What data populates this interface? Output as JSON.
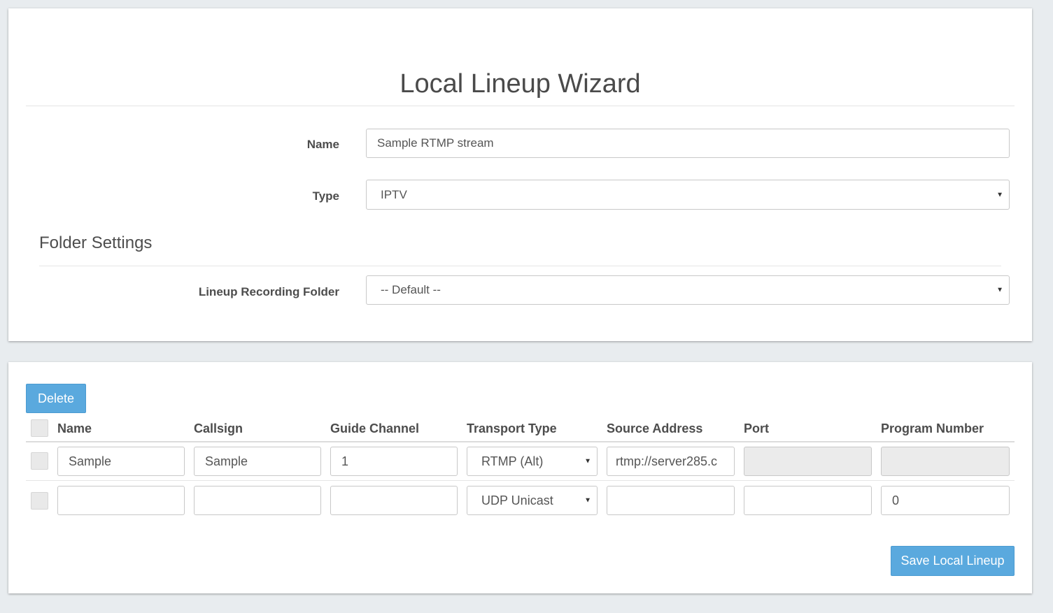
{
  "wizard": {
    "title": "Local Lineup Wizard",
    "name_label": "Name",
    "name_value": "Sample RTMP stream",
    "type_label": "Type",
    "type_value": "IPTV",
    "folder_section_title": "Folder Settings",
    "folder_label": "Lineup Recording Folder",
    "folder_value": "-- Default --"
  },
  "lineup": {
    "delete_label": "Delete",
    "save_label": "Save Local Lineup",
    "columns": [
      "Name",
      "Callsign",
      "Guide Channel",
      "Transport Type",
      "Source Address",
      "Port",
      "Program Number"
    ],
    "rows": [
      {
        "name": "Sample",
        "callsign": "Sample",
        "guide_channel": "1",
        "transport_type": "RTMP (Alt)",
        "source_address": "rtmp://server285.c",
        "port": "",
        "program_number": ""
      },
      {
        "name": "",
        "callsign": "",
        "guide_channel": "",
        "transport_type": "UDP Unicast",
        "source_address": "",
        "port": "",
        "program_number": "0"
      }
    ]
  },
  "icons": {
    "dropdown_caret": "▼"
  },
  "colors": {
    "page_background": "#e8ecef",
    "primary_button": "#5aa9de",
    "disabled_input": "#ebebeb"
  }
}
